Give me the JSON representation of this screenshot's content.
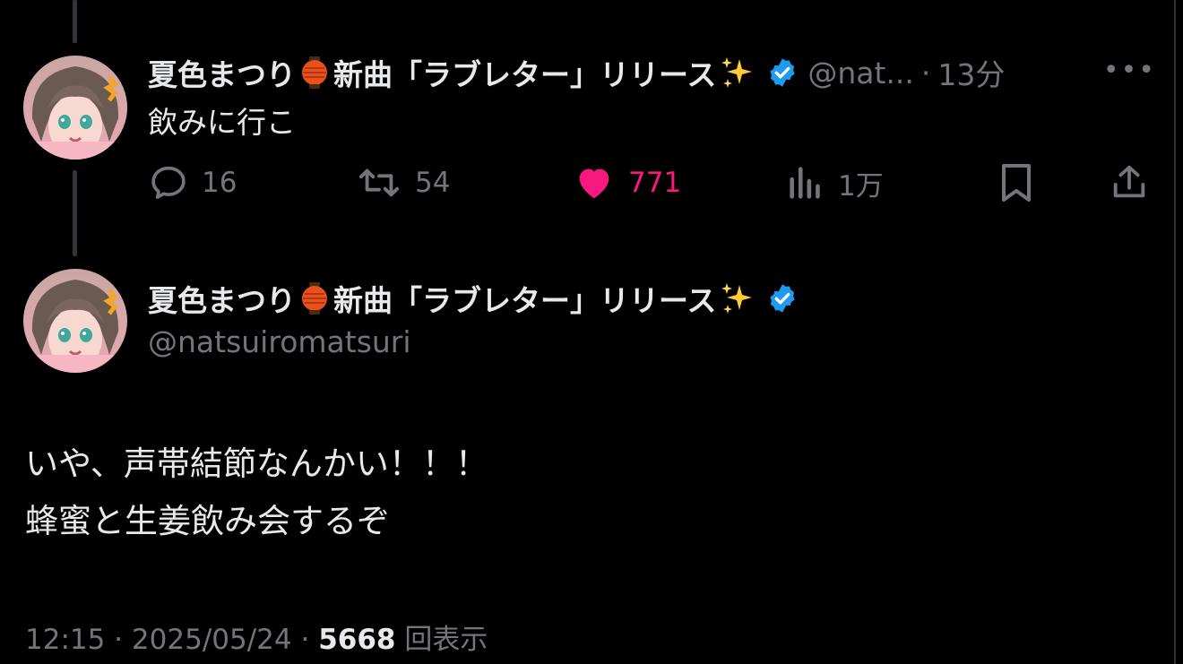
{
  "reply_tweet": {
    "display_name": "夏色まつり",
    "display_name_suffix": "新曲「ラブレター」リリース",
    "handle_short": "@nat...",
    "separator": "·",
    "time": "13分",
    "text": "飲みに行こ",
    "actions": {
      "replies": "16",
      "retweets": "54",
      "likes": "771",
      "views": "1万"
    },
    "like_color": "#f91880"
  },
  "main_tweet": {
    "display_name": "夏色まつり",
    "display_name_suffix": "新曲「ラブレター」リリース",
    "handle": "@natsuiromatsuri",
    "lines": [
      "いや、声帯結節なんかい！！！",
      "蜂蜜と生姜飲み会するぞ"
    ],
    "meta": {
      "time": "12:15",
      "date": "2025/05/24",
      "view_count": "5668",
      "views_label": "回表示"
    }
  },
  "colors": {
    "background": "#000000",
    "text": "#e7e9ea",
    "muted": "#71767b",
    "verified": "#1d9bf0"
  },
  "icons": [
    "lantern-emoji",
    "sparkles-emoji",
    "verified-badge-icon",
    "reply-icon",
    "retweet-icon",
    "heart-icon",
    "views-icon",
    "bookmark-icon",
    "share-icon",
    "more-icon"
  ]
}
